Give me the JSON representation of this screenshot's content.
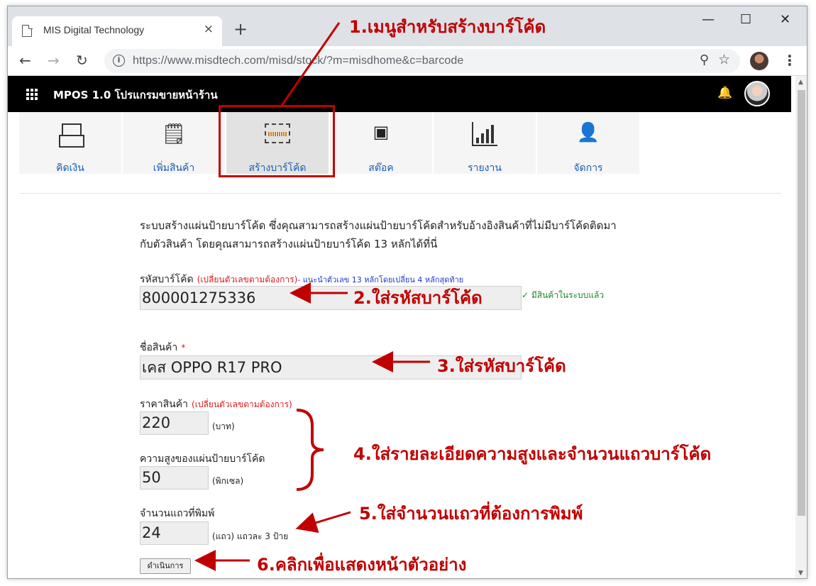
{
  "browser": {
    "tab_title": "MIS Digital Technology",
    "tab_close": "×",
    "new_tab": "+",
    "url": "https://www.misdtech.com/misd/stock/?m=misdhome&c=barcode",
    "window_minimize": "—",
    "window_maximize": "☐",
    "window_close": "✕"
  },
  "app": {
    "title": "MPOS 1.0 โปรแกรมขายหน้าร้าน"
  },
  "menu": {
    "items": [
      {
        "label": "คิดเงิน",
        "icon": "cash-register-icon"
      },
      {
        "label": "เพิ่มสินค้า",
        "icon": "add-item-icon"
      },
      {
        "label": "สร้างบาร์โค้ด",
        "icon": "barcode-scan-icon",
        "active": true
      },
      {
        "label": "สต๊อค",
        "icon": "stock-cubes-icon"
      },
      {
        "label": "รายงาน",
        "icon": "report-chart-icon"
      },
      {
        "label": "จัดการ",
        "icon": "user-settings-icon"
      }
    ]
  },
  "form": {
    "intro_line1": "ระบบสร้างแผ่นป้ายบาร์โค้ด ซึ่งคุณสามารถสร้างแผ่นป้ายบาร์โค้ดสำหรับอ้างอิงสินค้าที่ไม่มีบาร์โค้ดติดมา",
    "intro_line2": "กับตัวสินค้า โดยคุณสามารถสร้างแผ่นป้ายบาร์โค้ด 13 หลักได้ที่นี่",
    "barcode_label": "รหัสบาร์โค้ด",
    "barcode_note_red": "(เปลี่ยนตัวเลขตามต้องการ)",
    "barcode_note_blue": "- แนะนำตัวเลข 13 หลักโดยเปลี่ยน 4 หลักสุดท้าย",
    "barcode_value": "800001275336",
    "barcode_status": "✓ มีสินค้าในระบบแล้ว",
    "name_label": "ชื่อสินค้า",
    "name_required": "*",
    "name_value": "เคส OPPO R17 PRO",
    "price_label": "ราคาสินค้า",
    "price_note": "(เปลี่ยนตัวเลขตามต้องการ)",
    "price_value": "220",
    "price_unit": "(บาท)",
    "height_label": "ความสูงของแผ่นป้ายบาร์โค้ด",
    "height_value": "50",
    "height_unit": "(พิกเซล)",
    "rows_label": "จำนวนแถวที่พิมพ์",
    "rows_value": "24",
    "rows_unit": "(แถว) แถวละ 3 ป้าย",
    "submit_label": "ดำเนินการ"
  },
  "annotations": {
    "a1": "1.เมนูสำหรับสร้างบาร์โค้ด",
    "a2": "2.ใส่รหัสบาร์โค้ด",
    "a3": "3.ใส่รหัสบาร์โค้ด",
    "a4": "4.ใส่รายละเอียดความสูงและจำนวนแถวบาร์โค้ด",
    "a5": "5.ใส่จำนวนแถวที่ต้องการพิมพ์",
    "a6": "6.คลิกเพื่อแสดงหน้าตัวอย่าง"
  },
  "colors": {
    "annotation": "#c00000",
    "appbar": "#000000",
    "menu_label": "#1a5fb4"
  }
}
